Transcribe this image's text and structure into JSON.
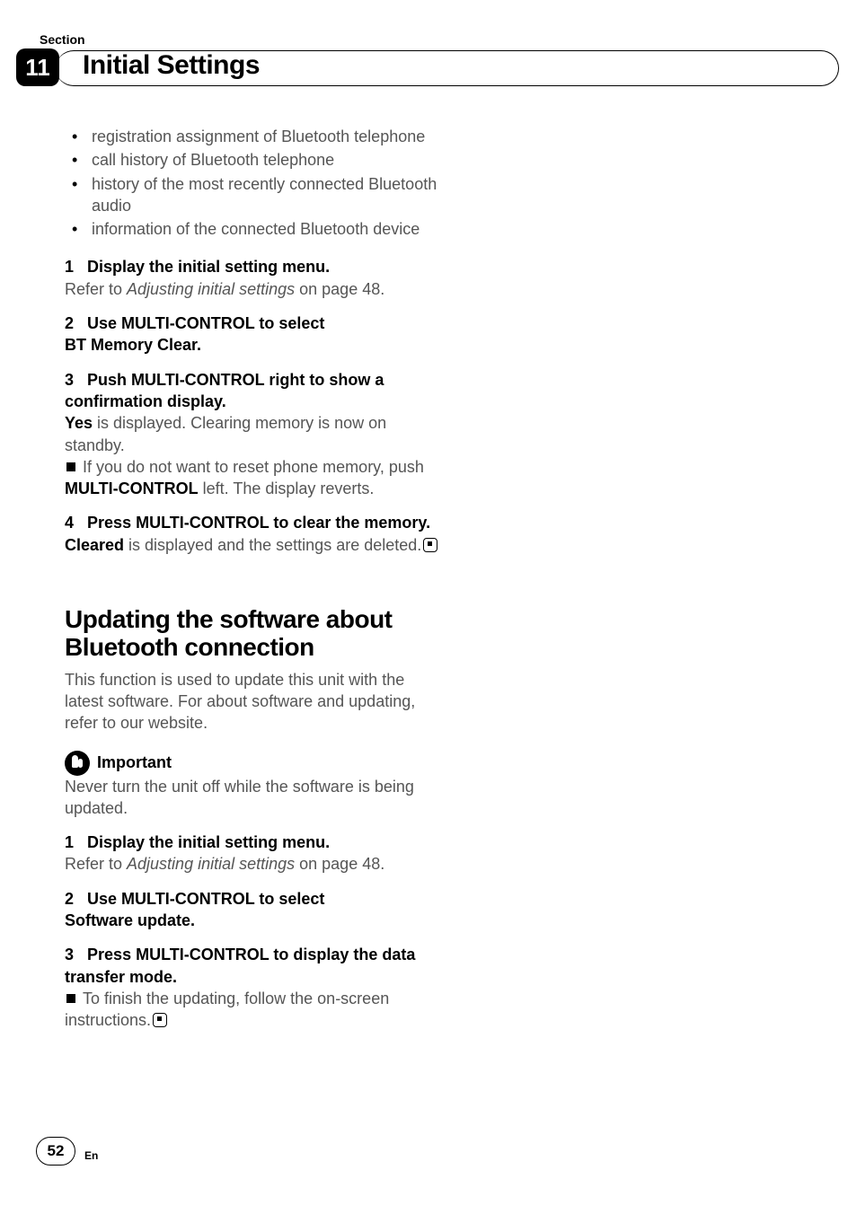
{
  "header": {
    "section_label": "Section",
    "section_number": "11",
    "chapter_title": "Initial Settings"
  },
  "bullets": [
    "registration assignment of Bluetooth telephone",
    "call history of Bluetooth telephone",
    "history of the most recently connected Bluetooth audio",
    "information of the connected Bluetooth device"
  ],
  "steps_a": {
    "s1": {
      "num": "1",
      "head": "Display the initial setting menu.",
      "refer_prefix": "Refer to ",
      "refer_italic": "Adjusting initial settings",
      "refer_suffix": " on page 48."
    },
    "s2": {
      "num": "2",
      "head_line1": "Use MULTI-CONTROL to select",
      "head_line2": "BT Memory Clear."
    },
    "s3": {
      "num": "3",
      "head": "Push MULTI-CONTROL right to show a confirmation display.",
      "body_bold": "Yes",
      "body_rest": " is displayed. Clearing memory is now on standby.",
      "note_prefix": "If you do not want to reset phone memory, push ",
      "note_bold": "MULTI-CONTROL",
      "note_suffix": " left. The display reverts."
    },
    "s4": {
      "num": "4",
      "head": "Press MULTI-CONTROL to clear the memory.",
      "body_bold": "Cleared",
      "body_rest": " is displayed and the settings are deleted."
    }
  },
  "section2": {
    "title": "Updating the software about Bluetooth connection",
    "intro": "This function is used to update this unit with the latest software. For about software and updating, refer to our website.",
    "important_label": "Important",
    "important_body": "Never turn the unit off while the software is being updated."
  },
  "steps_b": {
    "s1": {
      "num": "1",
      "head": "Display the initial setting menu.",
      "refer_prefix": "Refer to ",
      "refer_italic": "Adjusting initial settings",
      "refer_suffix": " on page 48."
    },
    "s2": {
      "num": "2",
      "head_line1": "Use MULTI-CONTROL to select",
      "head_line2": "Software update."
    },
    "s3": {
      "num": "3",
      "head": "Press MULTI-CONTROL to display the data transfer mode.",
      "note": "To finish the updating, follow the on-screen instructions."
    }
  },
  "footer": {
    "page": "52",
    "lang": "En"
  }
}
